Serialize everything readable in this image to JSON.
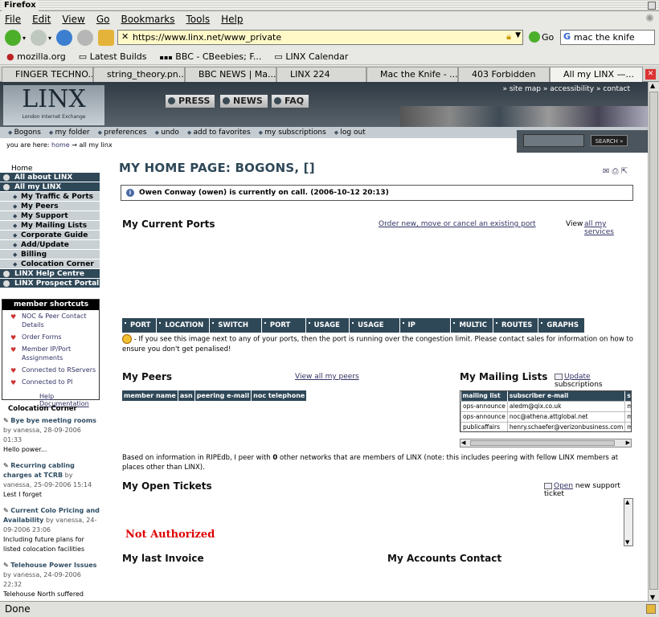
{
  "window": {
    "title": "Firefox"
  },
  "menu": [
    "File",
    "Edit",
    "View",
    "Go",
    "Bookmarks",
    "Tools",
    "Help"
  ],
  "nav": {
    "url": "https://www.linx.net/www_private",
    "go_label": "Go",
    "search_value": "mac the knife"
  },
  "bookmarks": [
    "mozilla.org",
    "Latest Builds",
    "BBC - CBeebies; F...",
    "LINX Calendar"
  ],
  "tabs": [
    "FINGER TECHNO...",
    "string_theory.pn...",
    "BBC NEWS | Ma...",
    "LINX 224",
    "Mac the Knife - ...",
    "403 Forbidden",
    "All my LINX —..."
  ],
  "status": "Done",
  "site": {
    "logo": "LINX",
    "logo_sub": "London Internet Exchange",
    "header_buttons": [
      "PRESS",
      "NEWS",
      "FAQ"
    ],
    "top_links": "» site map  » accessibility  » contact",
    "subnav": [
      "Bogons",
      "my folder",
      "preferences",
      "undo",
      "add to favorites",
      "my subscriptions",
      "log out"
    ],
    "crumb_prefix": "you are here:",
    "crumb_home": "home",
    "crumb_arrow": "→",
    "crumb_current": "all my linx",
    "search_button": "SEARCH »"
  },
  "leftnav": {
    "home": "Home",
    "items": [
      {
        "label": "All about LINX",
        "type": "sec"
      },
      {
        "label": "All my LINX",
        "type": "sec"
      },
      {
        "label": "My Traffic & Ports",
        "type": "sub"
      },
      {
        "label": "My Peers",
        "type": "sub"
      },
      {
        "label": "My Support",
        "type": "sub"
      },
      {
        "label": "My Mailing Lists",
        "type": "sub"
      },
      {
        "label": "Corporate Guide",
        "type": "sub"
      },
      {
        "label": "Add/Update Details",
        "type": "sub"
      },
      {
        "label": "Billing",
        "type": "sub"
      },
      {
        "label": "Colocation Corner",
        "type": "sub"
      },
      {
        "label": "LINX Help Centre",
        "type": "sec"
      },
      {
        "label": "LINX Prospect Portal",
        "type": "sec"
      }
    ],
    "shortcuts_title": "member shortcuts",
    "shortcuts": [
      "NOC & Peer Contact Details",
      "Order Forms",
      "Member IP/Port Assignments",
      "Connected to RServers",
      "Connected to PI"
    ],
    "help_doc": "Help Documentation",
    "coloc_title": "Colocation Corner",
    "news": [
      {
        "title": "Bye bye meeting rooms",
        "meta": "by vanessa, 28-09-2006 01:33",
        "body": "Hello power..."
      },
      {
        "title": "Recurring cabling charges at TCRB",
        "meta": "by vanessa, 25-09-2006 15:14",
        "body": "Lest I forget"
      },
      {
        "title": "Current Colo Pricing and Availability",
        "meta": "by vanessa, 24-09-2006 23:06",
        "body": "Including future plans for listed colocation facilities"
      },
      {
        "title": "Telehouse Power Issues",
        "meta": "by vanessa, 24-09-2006 22:32",
        "body": "Telehouse North suffered what was apparently a four minute"
      }
    ]
  },
  "main": {
    "title": "MY HOME PAGE: BOGONS, []",
    "oncall": "Owen Conway (owen) is currently on call. (2006-10-12 20:13)",
    "ports_title": "My Current Ports",
    "ports_order_link": "Order new, move or cancel an existing port",
    "view_label": "View",
    "view_services_link": "all my services",
    "port_columns": [
      "PORT",
      "LOCATION",
      "SWITCH NO.",
      "PORT NO.",
      "USAGE IN",
      "USAGE OUT",
      "IP ADDRESS",
      "MULTIC",
      "ROUTES",
      "GRAPHS"
    ],
    "congestion_note": "- If you see this image next to any of your ports, then the port is running over the congestion limit. Please contact sales for information on how to ensure you don't get penalised!",
    "peers_title": "My Peers",
    "peers_link": "View all my peers",
    "peer_columns": [
      "member name",
      "asn",
      "peering e-mail",
      "noc telephone"
    ],
    "mailing_title": "My Mailing Lists",
    "mailing_update": "Update",
    "mailing_update_suffix": "subscriptions",
    "mailing_columns": [
      "mailing list",
      "subscriber e-mail",
      "sta"
    ],
    "mailing_rows": [
      [
        "ops-announce",
        "aledm@qix.co.uk",
        "mai"
      ],
      [
        "ops-announce",
        "noc@athena.attglobal.net",
        "mai"
      ],
      [
        "publicaffairs",
        "henry.schaefer@verizonbusiness.com",
        "mai"
      ]
    ],
    "ripe_prefix": "Based on information in RIPEdb, I peer with",
    "ripe_count": "0",
    "ripe_suffix": "other networks that are members of LINX (note: this includes peering with fellow LINX members at places other than LINX).",
    "tickets_title": "My Open Tickets",
    "tickets_open": "Open",
    "tickets_open_suffix": "new support ticket",
    "not_authorized": "Not Authorized",
    "invoice_title": "My last Invoice",
    "accounts_title": "My Accounts Contact"
  }
}
